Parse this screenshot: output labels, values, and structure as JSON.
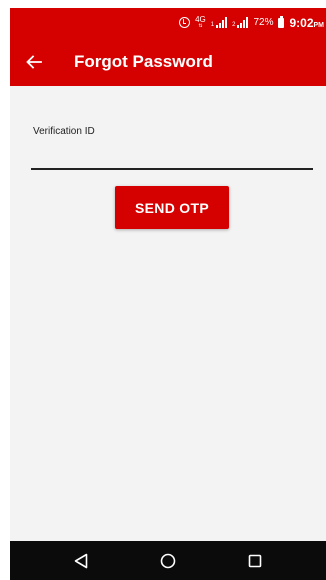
{
  "status_bar": {
    "network_type": "4G",
    "sim1_label": "1",
    "sim2_label": "2",
    "battery_percent": "72%",
    "time": "9:02",
    "time_suffix": "PM"
  },
  "app_bar": {
    "title": "Forgot Password",
    "back_icon": "arrow-left-icon",
    "background_color": "#d50000"
  },
  "form": {
    "field_label": "Verification ID",
    "field_value": "",
    "field_placeholder": "",
    "submit_label": "SEND OTP",
    "accent_color": "#d50000"
  },
  "nav_bar": {
    "back_icon": "triangle-back-icon",
    "home_icon": "circle-home-icon",
    "recents_icon": "square-recents-icon"
  }
}
